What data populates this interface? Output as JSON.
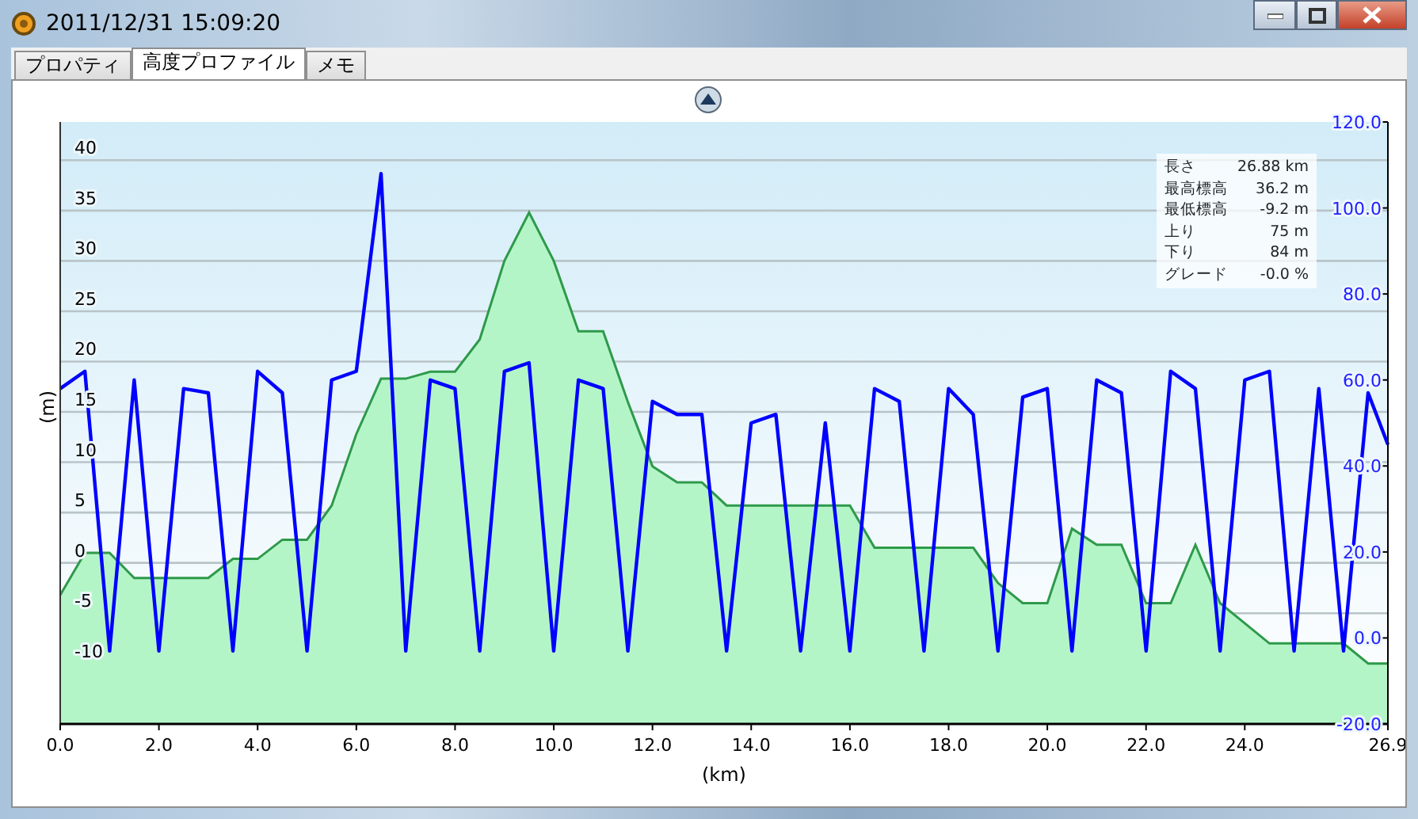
{
  "window": {
    "title": "2011/12/31 15:09:20"
  },
  "tabs": [
    {
      "label": "プロパティ",
      "selected": false
    },
    {
      "label": "高度プロファイル",
      "selected": true
    },
    {
      "label": "メモ",
      "selected": false
    }
  ],
  "stats": [
    {
      "label": "長さ",
      "value": "26.88 km"
    },
    {
      "label": "最高標高",
      "value": "36.2 m"
    },
    {
      "label": "最低標高",
      "value": "-9.2 m"
    },
    {
      "label": "上り",
      "value": "75 m"
    },
    {
      "label": "下り",
      "value": "84 m"
    },
    {
      "label": "グレード",
      "value": "-0.0 %"
    }
  ],
  "chart_data": {
    "type": "area",
    "grid": true,
    "xlabel": "(km)",
    "ylabel": "(m)",
    "xlim": [
      0,
      26.9
    ],
    "ylim": [
      -16,
      43.8
    ],
    "y2lim": [
      -20,
      120
    ],
    "xticks": [
      {
        "value": 0,
        "label": "0.0"
      },
      {
        "value": 2,
        "label": "2.0"
      },
      {
        "value": 4,
        "label": "4.0"
      },
      {
        "value": 6,
        "label": "6.0"
      },
      {
        "value": 8,
        "label": "8.0"
      },
      {
        "value": 10,
        "label": "10.0"
      },
      {
        "value": 12,
        "label": "12.0"
      },
      {
        "value": 14,
        "label": "14.0"
      },
      {
        "value": 16,
        "label": "16.0"
      },
      {
        "value": 18,
        "label": "18.0"
      },
      {
        "value": 20,
        "label": "20.0"
      },
      {
        "value": 22,
        "label": "22.0"
      },
      {
        "value": 24,
        "label": "24.0"
      },
      {
        "value": 26.9,
        "label": "26.9"
      }
    ],
    "yticks": [
      -10,
      -5,
      0,
      5,
      10,
      15,
      20,
      25,
      30,
      35,
      40
    ],
    "y2ticks": [
      {
        "value": -20,
        "label": "-20.0"
      },
      {
        "value": 0,
        "label": "0.0"
      },
      {
        "value": 20,
        "label": "20.0"
      },
      {
        "value": 40,
        "label": "40.0"
      },
      {
        "value": 60,
        "label": "60.0"
      },
      {
        "value": 80,
        "label": "80.0"
      },
      {
        "value": 100,
        "label": "100.0"
      },
      {
        "value": 120,
        "label": "120.0"
      }
    ],
    "x": [
      0,
      0.5,
      1,
      1.5,
      2,
      2.5,
      3,
      3.5,
      4,
      4.5,
      5,
      5.5,
      6,
      6.5,
      7,
      7.5,
      8,
      8.5,
      9,
      9.5,
      10,
      10.5,
      11,
      11.5,
      12,
      12.5,
      13,
      13.5,
      14,
      14.5,
      15,
      15.5,
      16,
      16.5,
      17,
      17.5,
      18,
      18.5,
      19,
      19.5,
      20,
      20.5,
      21,
      21.5,
      22,
      22.5,
      23,
      23.5,
      24,
      24.5,
      25,
      25.5,
      26,
      26.5,
      26.9
    ],
    "series": [
      {
        "color": "#2e9a4a",
        "values": [
          -3.2,
          1,
          1,
          -1.5,
          -1.5,
          -1.5,
          -1.5,
          0.4,
          0.4,
          2.3,
          2.3,
          5.7,
          12.8,
          18.3,
          18.3,
          19,
          19,
          22.2,
          30,
          34.8,
          30,
          23,
          23,
          16,
          9.6,
          8,
          8,
          5.7,
          5.7,
          5.7,
          5.7,
          5.7,
          5.7,
          1.5,
          1.5,
          1.5,
          1.5,
          1.5,
          -2,
          -4,
          -4,
          3.4,
          1.8,
          1.8,
          -4,
          -4,
          1.8,
          -4,
          -6,
          -8,
          -8,
          -8,
          -8,
          -10,
          -10
        ]
      },
      {
        "color": "#0000ff",
        "axis": "y2",
        "type": "line",
        "values": [
          58,
          62,
          -3,
          60,
          -3,
          58,
          57,
          -3,
          62,
          57,
          -3,
          60,
          62,
          108,
          -3,
          60,
          58,
          -3,
          62,
          64,
          -3,
          60,
          58,
          -3,
          55,
          52,
          52,
          -3,
          50,
          52,
          -3,
          50,
          -3,
          58,
          55,
          -3,
          58,
          52,
          -3,
          56,
          58,
          -3,
          60,
          57,
          -3,
          62,
          58,
          -3,
          60,
          62,
          -3,
          58,
          -3,
          57,
          45
        ]
      }
    ]
  }
}
